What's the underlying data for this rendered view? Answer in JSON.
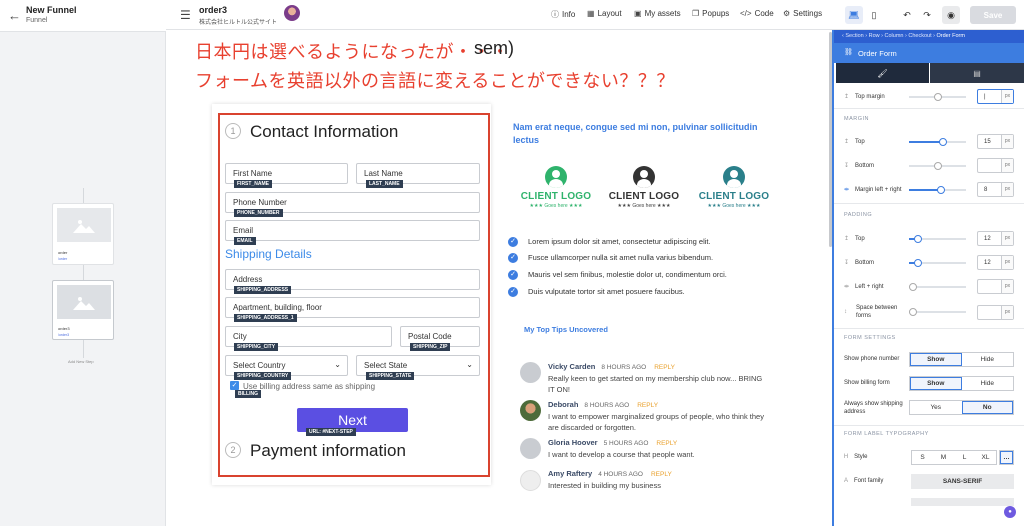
{
  "left_panel": {
    "title": "New Funnel",
    "subtitle": "Funnel",
    "steps": [
      {
        "title": "order",
        "link": "/order"
      },
      {
        "title": "order3",
        "link": "/order3"
      }
    ],
    "add_step": "Add New Step"
  },
  "topbar": {
    "page_title": "order3",
    "site_name": "株式会社ヒルトル公式サイト",
    "items": [
      "Info",
      "Layout",
      "My assets",
      "Popups",
      "Code",
      "Settings"
    ],
    "save_label": "Save"
  },
  "annotation": {
    "line1": "日本円は選べるようになったが・・・",
    "line2": "フォームを英語以外の言語に変えることができない？？？",
    "residual": "sem)"
  },
  "form": {
    "contact_num": "1",
    "contact_title": "Contact Information",
    "first_name": "First Name",
    "first_name_tag": "FIRST_NAME",
    "last_name": "Last Name",
    "last_name_tag": "LAST_NAME",
    "phone": "Phone Number",
    "phone_tag": "PHONE_NUMBER",
    "email": "Email",
    "email_tag": "EMAIL",
    "shipping_title": "Shipping Details",
    "address": "Address",
    "address_tag": "SHIPPING_ADDRESS",
    "apartment": "Apartment, building, floor",
    "apartment_tag": "SHIPPING_ADDRESS_1",
    "city": "City",
    "city_tag": "SHIPPING_CITY",
    "postal": "Postal Code",
    "postal_tag": "SHIPPING_ZIP",
    "country": "Select Country",
    "country_tag": "SHIPPING_COUNTRY",
    "state": "Select State",
    "state_tag": "SHIPPING_STATE",
    "billing_label": "Use billing address same as shipping",
    "billing_tag": "BILLING",
    "next_label": "Next",
    "next_tag": "URL: #NEXT-STEP",
    "payment_num": "2",
    "payment_title": "Payment information"
  },
  "content": {
    "heading": "Nam erat neque, congue sed mi non, pulvinar sollicitudin lectus",
    "logos": [
      {
        "name": "CLIENT LOGO",
        "sub": "★★★  Goes here  ★★★",
        "color": "#2fb36c"
      },
      {
        "name": "CLIENT LOGO",
        "sub": "★★★  Goes here  ★★★",
        "color": "#333333"
      },
      {
        "name": "CLIENT LOGO",
        "sub": "★★★  Goes here  ★★★",
        "color": "#2a7f8a"
      }
    ],
    "checks": [
      "Lorem ipsum dolor sit amet, consectetur adipiscing elit.",
      "Fusce ullamcorper nulla sit amet nulla varius bibendum.",
      "Mauris vel sem finibus, molestie dolor ut, condimentum orci.",
      "Duis vulputate tortor sit amet posuere faucibus."
    ],
    "tips_title": "My Top Tips Uncovered",
    "comments": [
      {
        "name": "Vicky Carden",
        "time": "8 HOURS AGO",
        "reply": "REPLY",
        "text": "Really keen to get started on my membership club now... BRING IT ON!"
      },
      {
        "name": "Deborah",
        "time": "8 HOURS AGO",
        "reply": "REPLY",
        "text": "I want to empower marginalized groups of people, who think they are discarded or forgotten."
      },
      {
        "name": "Gloria Hoover",
        "time": "5 HOURS AGO",
        "reply": "REPLY",
        "text": "I want to develop a course that people want."
      },
      {
        "name": "Amy Raftery",
        "time": "4 HOURS AGO",
        "reply": "REPLY",
        "text": "Interested in building my business"
      }
    ]
  },
  "settings": {
    "breadcrumb": [
      "Section",
      "Row",
      "Column",
      "Checkout",
      "Order Form"
    ],
    "title": "Order Form",
    "top_margin_label": "Top margin",
    "top_margin_value": "",
    "margin_section": "MARGIN",
    "margin_top_label": "Top",
    "margin_top_value": "15",
    "margin_bottom_label": "Bottom",
    "margin_bottom_value": "",
    "margin_lr_label": "Margin left + right",
    "margin_lr_value": "8",
    "padding_section": "PADDING",
    "padding_top_label": "Top",
    "padding_top_value": "12",
    "padding_bottom_label": "Bottom",
    "padding_bottom_value": "12",
    "padding_lr_label": "Left + right",
    "padding_lr_value": "",
    "space_label_1": "Space between",
    "space_label_2": "forms",
    "space_value": "",
    "unit": "px",
    "form_settings_section": "FORM SETTINGS",
    "show_phone_label": "Show phone number",
    "show_billing_label": "Show billing form",
    "always_ship_label_1": "Always show shipping",
    "always_ship_label_2": "address",
    "show": "Show",
    "hide": "Hide",
    "yes": "Yes",
    "no": "No",
    "typography_section": "FORM LABEL TYPOGRAPHY",
    "style_label": "Style",
    "sizes": [
      "S",
      "M",
      "L",
      "XL",
      "…"
    ],
    "font_family_label": "Font family",
    "font_family_value": "SANS-SERIF"
  }
}
